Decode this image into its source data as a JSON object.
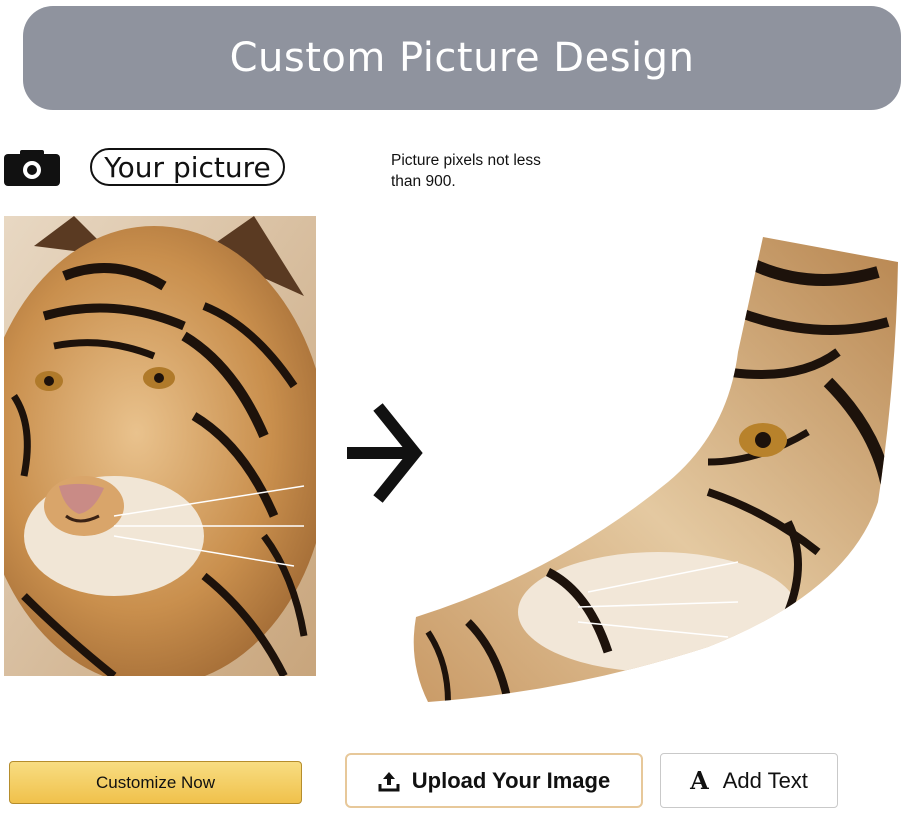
{
  "header": {
    "title": "Custom Picture Design"
  },
  "upload_section": {
    "camera_icon": "camera-icon",
    "your_picture_label": "Your picture",
    "note": "Picture pixels not less than 900."
  },
  "preview": {
    "source_image": "tiger-face-photo",
    "arrow_icon": "arrow-right-icon",
    "result_image": "tiger-print-arm-sleeve"
  },
  "actions": {
    "customize_label": "Customize Now",
    "upload_label": "Upload Your Image",
    "upload_icon": "upload-icon",
    "add_text_label": "Add Text",
    "add_text_icon": "text-a-icon"
  },
  "colors": {
    "header_bg": "#8f939e",
    "customize_button": "#f0c14b",
    "upload_border": "#e7c89a"
  }
}
